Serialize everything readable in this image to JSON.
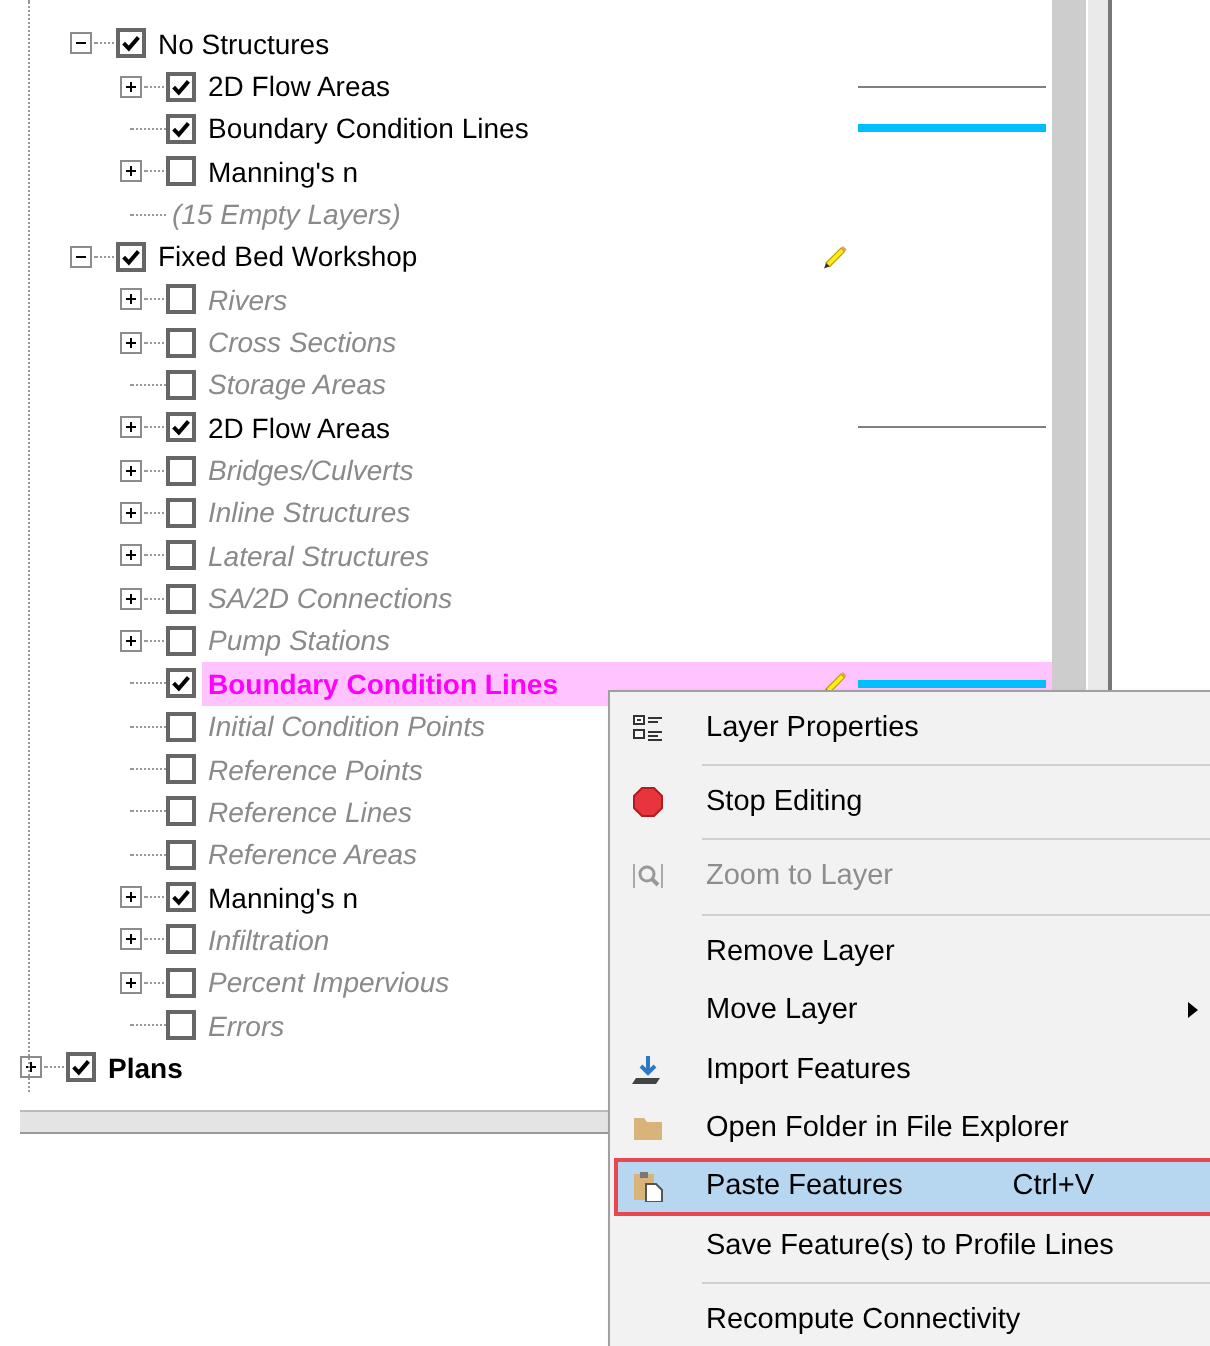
{
  "tree": [
    {
      "children": [
        {
          "label": "No Structures",
          "checked": true,
          "expanded": true,
          "empty": false,
          "editing": false,
          "selected": false,
          "children": [
            {
              "label": "2D Flow Areas",
              "checked": true,
              "expanded": false,
              "empty": false,
              "editing": false,
              "selected": false,
              "legend": {
                "color": "#808080",
                "kind": "thin"
              }
            },
            {
              "label": "Boundary Condition Lines",
              "checked": true,
              "empty": false,
              "editing": false,
              "selected": false,
              "legend": {
                "color": "#00bfff",
                "kind": "thick"
              }
            },
            {
              "label": "Manning's n",
              "checked": false,
              "expanded": false,
              "empty": false,
              "editing": false,
              "selected": false
            },
            {
              "label": "(15 Empty Layers)",
              "kind": "note"
            }
          ]
        },
        {
          "label": "Fixed Bed Workshop",
          "checked": true,
          "expanded": true,
          "empty": false,
          "editing": true,
          "selected": false,
          "children": [
            {
              "label": "Rivers",
              "checked": false,
              "expanded": false,
              "empty": true,
              "editing": false,
              "selected": false
            },
            {
              "label": "Cross Sections",
              "checked": false,
              "expanded": false,
              "empty": true,
              "editing": false,
              "selected": false
            },
            {
              "label": "Storage Areas",
              "checked": false,
              "empty": true,
              "editing": false,
              "selected": false
            },
            {
              "label": "2D Flow Areas",
              "checked": true,
              "expanded": false,
              "empty": false,
              "editing": false,
              "selected": false,
              "legend": {
                "color": "#808080",
                "kind": "thin"
              }
            },
            {
              "label": "Bridges/Culverts",
              "checked": false,
              "expanded": false,
              "empty": true,
              "editing": false,
              "selected": false
            },
            {
              "label": "Inline Structures",
              "checked": false,
              "expanded": false,
              "empty": true,
              "editing": false,
              "selected": false
            },
            {
              "label": "Lateral Structures",
              "checked": false,
              "expanded": false,
              "empty": true,
              "editing": false,
              "selected": false
            },
            {
              "label": "SA/2D Connections",
              "checked": false,
              "expanded": false,
              "empty": true,
              "editing": false,
              "selected": false
            },
            {
              "label": "Pump Stations",
              "checked": false,
              "expanded": false,
              "empty": true,
              "editing": false,
              "selected": false
            },
            {
              "label": "Boundary Condition Lines",
              "checked": true,
              "empty": false,
              "editing": true,
              "selected": true,
              "legend": {
                "color": "#00bfff",
                "kind": "thick"
              }
            },
            {
              "label": "Initial Condition Points",
              "checked": false,
              "empty": true,
              "editing": false,
              "selected": false
            },
            {
              "label": "Reference Points",
              "checked": false,
              "empty": true,
              "editing": false,
              "selected": false
            },
            {
              "label": "Reference Lines",
              "checked": false,
              "empty": true,
              "editing": false,
              "selected": false
            },
            {
              "label": "Reference Areas",
              "checked": false,
              "empty": true,
              "editing": false,
              "selected": false
            },
            {
              "label": "Manning's n",
              "checked": true,
              "expanded": false,
              "empty": false,
              "editing": false,
              "selected": false
            },
            {
              "label": "Infiltration",
              "checked": false,
              "expanded": false,
              "empty": true,
              "editing": false,
              "selected": false
            },
            {
              "label": "Percent Impervious",
              "checked": false,
              "expanded": false,
              "empty": true,
              "editing": false,
              "selected": false
            },
            {
              "label": "Errors",
              "checked": false,
              "empty": true,
              "editing": false,
              "selected": false
            }
          ]
        }
      ]
    },
    {
      "label": "Plans",
      "checked": true,
      "expanded": false,
      "empty": false,
      "selected": false,
      "bold": true
    }
  ],
  "context_menu": [
    {
      "kind": "item",
      "label": "Layer Properties",
      "disabled": false,
      "selected": false,
      "submenu": false
    },
    {
      "kind": "separator"
    },
    {
      "kind": "item",
      "label": "Stop Editing",
      "disabled": false,
      "selected": false,
      "submenu": false
    },
    {
      "kind": "separator"
    },
    {
      "kind": "item",
      "label": "Zoom to Layer",
      "disabled": true,
      "selected": false,
      "submenu": false
    },
    {
      "kind": "separator"
    },
    {
      "kind": "item",
      "label": "Remove Layer",
      "disabled": false,
      "selected": false,
      "submenu": false
    },
    {
      "kind": "item",
      "label": "Move Layer",
      "disabled": false,
      "selected": false,
      "submenu": true
    },
    {
      "kind": "item",
      "label": "Import Features",
      "disabled": false,
      "selected": false,
      "submenu": false
    },
    {
      "kind": "item",
      "label": "Open Folder in File Explorer",
      "disabled": false,
      "selected": false,
      "submenu": false
    },
    {
      "kind": "item",
      "label": "Paste Features",
      "shortcut": "Ctrl+V",
      "disabled": false,
      "selected": true,
      "submenu": false
    },
    {
      "kind": "item",
      "label": "Save Feature(s) to Profile Lines",
      "disabled": false,
      "selected": false,
      "submenu": false
    },
    {
      "kind": "separator"
    },
    {
      "kind": "item",
      "label": "Recompute Connectivity",
      "disabled": false,
      "selected": false,
      "submenu": false
    }
  ]
}
